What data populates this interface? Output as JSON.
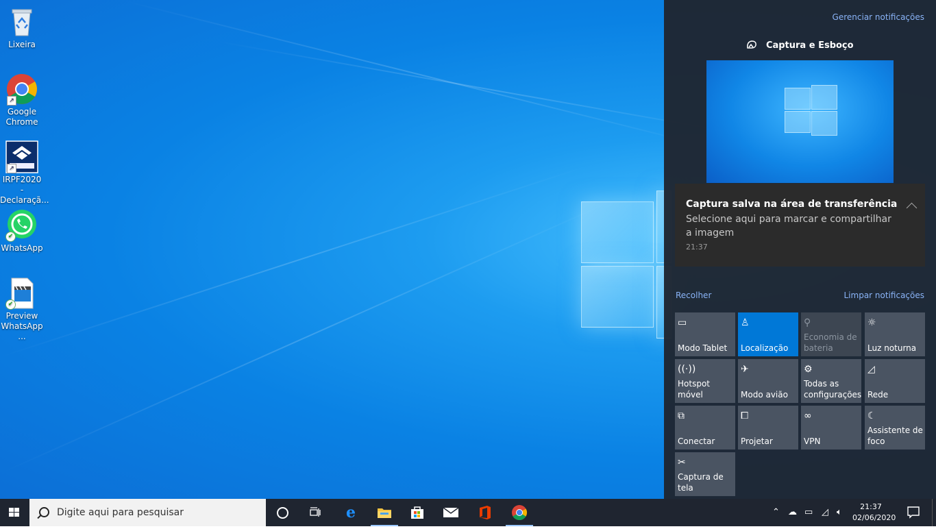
{
  "desktop": {
    "icons": [
      {
        "label": "Lixeira"
      },
      {
        "label": "Google Chrome"
      },
      {
        "label": "IRPF2020 - Declaraçã..."
      },
      {
        "label": "WhatsApp"
      },
      {
        "label": "Preview WhatsApp ..."
      }
    ]
  },
  "action_center": {
    "manage_label": "Gerenciar notificações",
    "app_name": "Captura e Esboço",
    "notification": {
      "title": "Captura salva na área de transferência",
      "body": "Selecione aqui para marcar e compartilhar a imagem",
      "time": "21:37"
    },
    "collapse_label": "Recolher",
    "clear_label": "Limpar notificações",
    "tiles": [
      {
        "label": "Modo Tablet",
        "icon": "tablet-icon",
        "state": "off"
      },
      {
        "label": "Localização",
        "icon": "location-icon",
        "state": "on"
      },
      {
        "label": "Economia de bateria",
        "icon": "battery-saver-icon",
        "state": "disabled"
      },
      {
        "label": "Luz noturna",
        "icon": "brightness-icon",
        "state": "off"
      },
      {
        "label": "Hotspot móvel",
        "icon": "hotspot-icon",
        "state": "off"
      },
      {
        "label": "Modo avião",
        "icon": "airplane-icon",
        "state": "off"
      },
      {
        "label": "Todas as configurações",
        "icon": "gear-icon",
        "state": "off"
      },
      {
        "label": "Rede",
        "icon": "network-icon",
        "state": "off"
      },
      {
        "label": "Conectar",
        "icon": "connect-icon",
        "state": "off"
      },
      {
        "label": "Projetar",
        "icon": "project-icon",
        "state": "off"
      },
      {
        "label": "VPN",
        "icon": "vpn-icon",
        "state": "off"
      },
      {
        "label": "Assistente de foco",
        "icon": "moon-icon",
        "state": "off"
      },
      {
        "label": "Captura de tela",
        "icon": "snip-icon",
        "state": "off"
      }
    ]
  },
  "taskbar": {
    "search_placeholder": "Digite aqui para pesquisar",
    "time": "21:37",
    "date": "02/06/2020"
  },
  "colors": {
    "accent": "#0078d7",
    "panel": "#1f2632",
    "tile": "#4a5462",
    "taskbar": "#1f2530"
  }
}
